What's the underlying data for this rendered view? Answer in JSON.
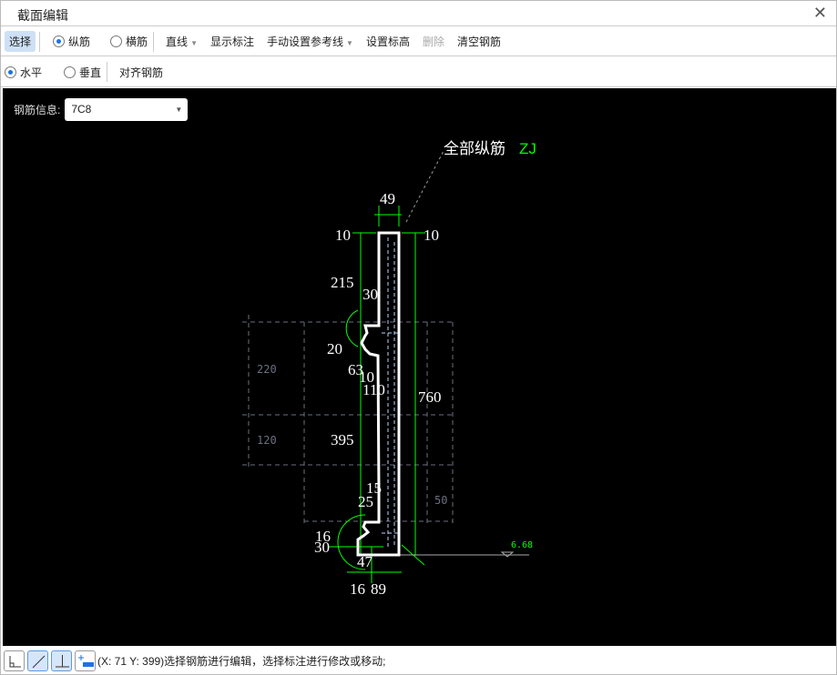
{
  "window": {
    "title": "截面编辑",
    "close": "✕"
  },
  "toolbar1": {
    "select": "选择",
    "longitudinal": "纵筋",
    "transverse": "横筋",
    "line": "直线",
    "show_dims": "显示标注",
    "manual_ref": "手动设置参考线",
    "set_elev": "设置标高",
    "delete": "删除",
    "clear": "清空钢筋"
  },
  "toolbar2": {
    "horizontal": "水平",
    "vertical": "垂直",
    "align": "对齐钢筋"
  },
  "rebar_info": {
    "label": "钢筋信息:",
    "value": "7C8"
  },
  "drawing": {
    "callout_text": "全部纵筋",
    "callout_code": "ZJ",
    "dims": {
      "d49": "49",
      "d10a": "10",
      "d10b": "10",
      "d215": "215",
      "d30a": "30",
      "d20": "20",
      "d63": "63",
      "d10c": "10",
      "d110": "110",
      "d760": "760",
      "d395": "395",
      "d15": "15",
      "d25": "25",
      "d16a": "16",
      "d30b": "30",
      "d47": "47",
      "d16b": "16",
      "d89": "89"
    },
    "ref": {
      "r220": "220",
      "r120": "120",
      "r50": "50"
    },
    "elevation": "6.68"
  },
  "status": {
    "text": "(X: 71 Y: 399)选择钢筋进行编辑，选择标注进行修改或移动;"
  },
  "colors": {
    "accent": "#1a73e8",
    "dim_green": "#00ff00",
    "canvas": "#000000"
  }
}
